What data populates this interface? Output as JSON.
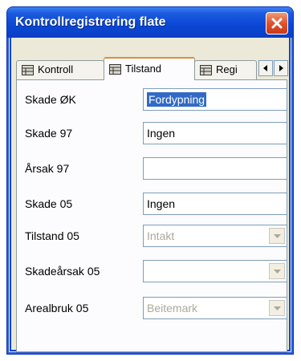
{
  "window": {
    "title": "Kontrollregistrering flate"
  },
  "tabs": [
    {
      "label": "Kontroll",
      "active": false
    },
    {
      "label": "Tilstand",
      "active": true
    },
    {
      "label": "Regi",
      "active": false
    }
  ],
  "fields": [
    {
      "label": "Skade ØK",
      "value": "Fordypning",
      "selected": true,
      "type": "text",
      "enabled": true
    },
    {
      "label": "Skade 97",
      "value": "Ingen",
      "type": "text",
      "enabled": true
    },
    {
      "label": "Årsak 97",
      "value": "",
      "type": "text",
      "enabled": true
    },
    {
      "label": "Skade 05",
      "value": "Ingen",
      "type": "text",
      "enabled": true
    },
    {
      "label": "Tilstand 05",
      "value": "Intakt",
      "type": "combo",
      "enabled": false
    },
    {
      "label": "Skadeårsak 05",
      "value": "",
      "type": "combo",
      "enabled": false
    },
    {
      "label": "Arealbruk 05",
      "value": "Beitemark",
      "type": "combo",
      "enabled": false
    }
  ],
  "colors": {
    "titlebar": "#0a47d4",
    "close": "#e0532c",
    "selection": "#316ac5",
    "active_tab_accent": "#e68b2c"
  },
  "icons": {
    "close": "close-icon",
    "tab": "table-icon",
    "scroll_left": "arrow-left-icon",
    "scroll_right": "arrow-right-icon",
    "combo": "chevron-down-icon"
  }
}
